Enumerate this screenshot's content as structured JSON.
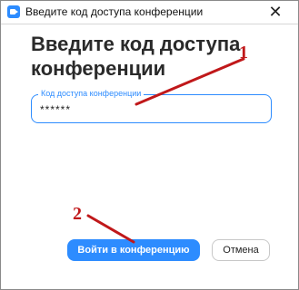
{
  "window": {
    "title": "Введите код доступа конференции",
    "close_glyph": "✕"
  },
  "heading": "Введите код доступа конференции",
  "passcode_field": {
    "label": "Код доступа конференции",
    "value": "******"
  },
  "annotations": {
    "step1": "1",
    "step2": "2",
    "color": "#c0181a"
  },
  "buttons": {
    "join": "Войти в конференцию",
    "cancel": "Отмена"
  },
  "colors": {
    "accent": "#2d8cff",
    "annotation": "#c0181a"
  },
  "icons": {
    "app": "zoom-camera-icon",
    "close": "close-icon"
  }
}
